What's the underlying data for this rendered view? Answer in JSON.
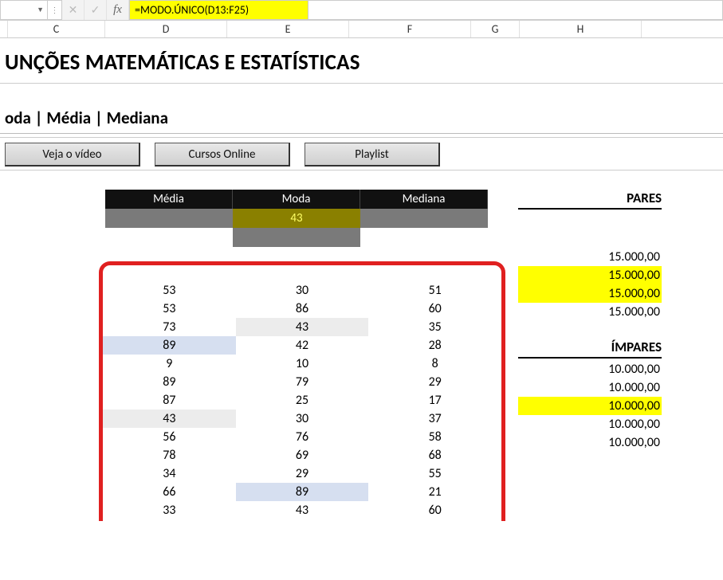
{
  "formula_bar": {
    "namebox": "",
    "formula": "=MODO.ÚNICO(D13:F25)",
    "fx_label": "fx",
    "cancel_icon": "✕",
    "confirm_icon": "✓"
  },
  "columns": {
    "C": "C",
    "D": "D",
    "E": "E",
    "F": "F",
    "G": "G",
    "H": "H"
  },
  "title": "UNÇÕES MATEMÁTICAS E ESTATÍSTICAS",
  "subtitle": "oda | Média | Mediana",
  "buttons": {
    "video": "Veja o vídeo",
    "cursos": "Cursos Online",
    "playlist": "Playlist"
  },
  "mini": {
    "headers": {
      "media": "Média",
      "moda": "Moda",
      "mediana": "Mediana"
    },
    "values": {
      "media": "",
      "moda": "43",
      "mediana": ""
    }
  },
  "data_rows": [
    {
      "d": "53",
      "e": "30",
      "f": "51"
    },
    {
      "d": "53",
      "e": "86",
      "f": "60"
    },
    {
      "d": "73",
      "e": "43",
      "f": "35",
      "e_hl": "grey"
    },
    {
      "d": "89",
      "e": "42",
      "f": "28",
      "d_hl": "blue"
    },
    {
      "d": "9",
      "e": "10",
      "f": "8"
    },
    {
      "d": "89",
      "e": "79",
      "f": "29"
    },
    {
      "d": "87",
      "e": "25",
      "f": "17"
    },
    {
      "d": "43",
      "e": "30",
      "f": "37",
      "d_hl": "grey"
    },
    {
      "d": "56",
      "e": "76",
      "f": "58"
    },
    {
      "d": "78",
      "e": "69",
      "f": "68"
    },
    {
      "d": "34",
      "e": "29",
      "f": "55"
    },
    {
      "d": "66",
      "e": "89",
      "f": "21",
      "e_hl": "blue"
    },
    {
      "d": "33",
      "e": "43",
      "f": "60"
    }
  ],
  "pares": {
    "label": "PARES",
    "rows": [
      {
        "v": "15.000,00"
      },
      {
        "v": "15.000,00",
        "hl": true
      },
      {
        "v": "15.000,00",
        "hl": true
      },
      {
        "v": "15.000,00"
      }
    ]
  },
  "impares": {
    "label": "ÍMPARES",
    "rows": [
      {
        "v": "10.000,00"
      },
      {
        "v": "10.000,00"
      },
      {
        "v": "10.000,00",
        "hl": true
      },
      {
        "v": "10.000,00"
      },
      {
        "v": "10.000,00"
      }
    ]
  }
}
